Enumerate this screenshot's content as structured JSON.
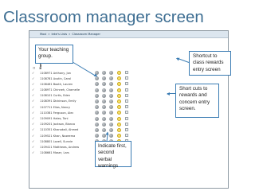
{
  "slide": {
    "title": "Classroom manager screen"
  },
  "screenshot": {
    "breadcrumb": [
      "Moxi",
      "Ieke's Lists",
      "Classroom Manager"
    ],
    "breadcrumb_separator": "»",
    "column_headers": {
      "tick_column": "D",
      "name_column": "Names"
    },
    "students": [
      {
        "name": "1108971 Anthony, Jon",
        "tick": "✓"
      },
      {
        "name": "1108781 Austin, Carol",
        "tick": "✓"
      },
      {
        "name": "1108461 Booth, Lauren",
        "tick": "✓"
      },
      {
        "name": "1108971 Chinneh, Charnelle",
        "tick": "✓"
      },
      {
        "name": "1108101 Curtis, Eden",
        "tick": "✓"
      },
      {
        "name": "1108391 Dickinson, Emily",
        "tick": "✓"
      },
      {
        "name": "1107711 Elias, Nancy",
        "tick": "✓"
      },
      {
        "name": "1110381 Ferguson, Alec",
        "tick": "✓"
      },
      {
        "name": "1109091 Hales, Toni",
        "tick": "✓"
      },
      {
        "name": "1109201 Jackson, Bianca",
        "tick": "✓"
      },
      {
        "name": "1110351 Khanakali, Ahmed",
        "tick": "✓"
      },
      {
        "name": "1109521 Khan, Nazeema",
        "tick": "✓"
      },
      {
        "name": "1108801 Lovell, Sunnie",
        "tick": "✓"
      },
      {
        "name": "1109411 Matthews, Andrew",
        "tick": "✓"
      },
      {
        "name": "1108661 Moser, Lars",
        "tick": "✓"
      }
    ],
    "icon_names": {
      "status_dot": "status-circle-icon",
      "reward": "smiley-face-icon",
      "select": "checkbox-icon"
    }
  },
  "callouts": {
    "teaching_group": "Your teaching group.",
    "shortcut_rewards": "Shortcut to class rewards entry screen",
    "shortcuts_rewards_concern": "Short cuts to rewards and concern entry screen.",
    "warnings": "Indicate first, second verbal warnings"
  },
  "colors": {
    "title": "#3f6f93",
    "callout_border": "#3b7cb3",
    "header_bar": "#dce6ef",
    "reward_icon": "#f8e36a"
  }
}
